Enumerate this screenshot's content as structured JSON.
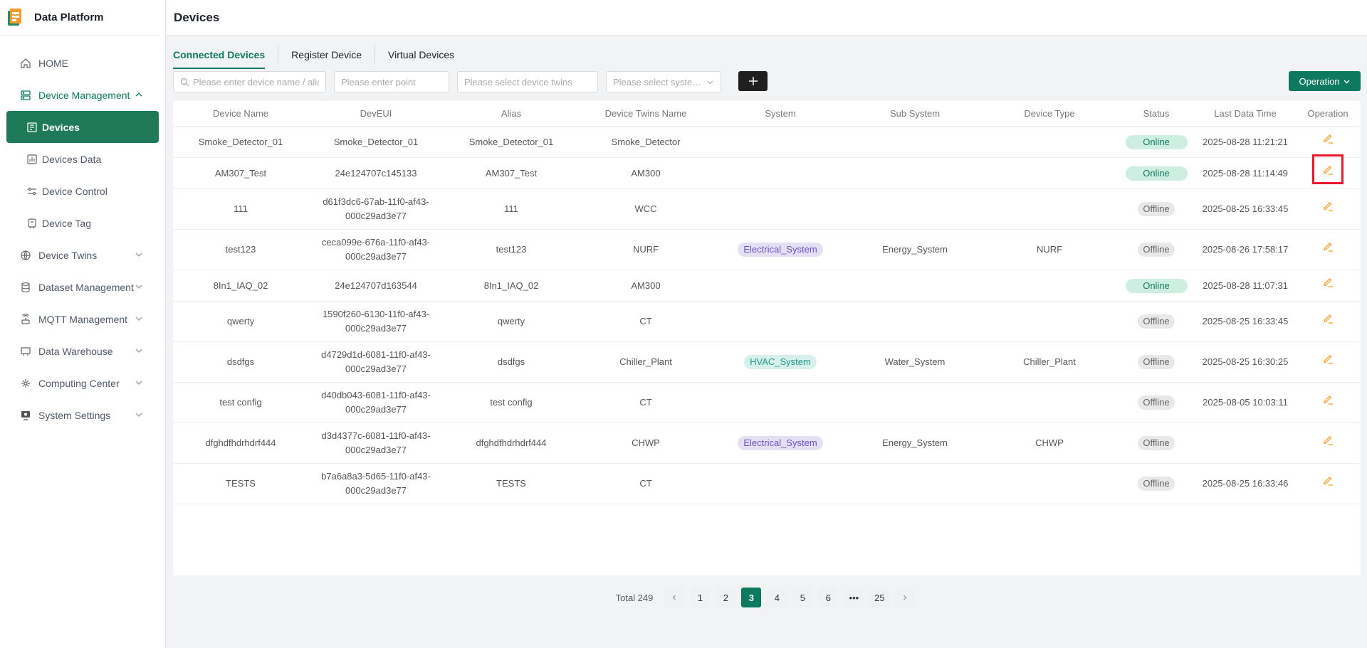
{
  "app": {
    "title": "Data Platform",
    "page_title": "Devices"
  },
  "sidebar": {
    "items": [
      {
        "label": "HOME",
        "icon": "home-icon"
      },
      {
        "label": "Device Management",
        "icon": "device-management-icon"
      },
      {
        "label": "Devices",
        "icon": "devices-icon"
      },
      {
        "label": "Devices Data",
        "icon": "devices-data-icon"
      },
      {
        "label": "Device Control",
        "icon": "device-control-icon"
      },
      {
        "label": "Device Tag",
        "icon": "device-tag-icon"
      },
      {
        "label": "Device Twins",
        "icon": "device-twins-icon"
      },
      {
        "label": "Dataset Management",
        "icon": "dataset-icon"
      },
      {
        "label": "MQTT Management",
        "icon": "mqtt-icon"
      },
      {
        "label": "Data Warehouse",
        "icon": "warehouse-icon"
      },
      {
        "label": "Computing Center",
        "icon": "computing-icon"
      },
      {
        "label": "System Settings",
        "icon": "settings-icon"
      }
    ]
  },
  "tabs": [
    "Connected Devices",
    "Register Device",
    "Virtual Devices"
  ],
  "filters": {
    "device_name_placeholder": "Please enter device name / alias",
    "point_placeholder": "Please enter point",
    "twins_placeholder": "Please select device twins",
    "system_placeholder": "Please select syste…",
    "operation_label": "Operation"
  },
  "table": {
    "columns": [
      "Device Name",
      "DevEUI",
      "Alias",
      "Device Twins Name",
      "System",
      "Sub System",
      "Device Type",
      "Status",
      "Last Data Time",
      "Operation"
    ],
    "rows": [
      {
        "name": "Smoke_Detector_01",
        "deveui": "Smoke_Detector_01",
        "deveui2": "",
        "alias": "Smoke_Detector_01",
        "twins": "Smoke_Detector",
        "system": "",
        "subsystem": "",
        "type": "",
        "status": "Online",
        "time": "2025-08-28 11:21:21"
      },
      {
        "name": "AM307_Test",
        "deveui": "24e124707c145133",
        "deveui2": "",
        "alias": "AM307_Test",
        "twins": "AM300",
        "system": "",
        "subsystem": "",
        "type": "",
        "status": "Online",
        "time": "2025-08-28 11:14:49"
      },
      {
        "name": "111",
        "deveui": "d61f3dc6-67ab-11f0-af43-",
        "deveui2": "000c29ad3e77",
        "alias": "111",
        "twins": "WCC",
        "system": "",
        "subsystem": "",
        "type": "",
        "status": "Offline",
        "time": "2025-08-25 16:33:45"
      },
      {
        "name": "test123",
        "deveui": "ceca099e-676a-11f0-af43-",
        "deveui2": "000c29ad3e77",
        "alias": "test123",
        "twins": "NURF",
        "system": "Electrical_System",
        "subsystem": "Energy_System",
        "type": "NURF",
        "status": "Offline",
        "time": "2025-08-26 17:58:17"
      },
      {
        "name": "8In1_IAQ_02",
        "deveui": "24e124707d163544",
        "deveui2": "",
        "alias": "8In1_IAQ_02",
        "twins": "AM300",
        "system": "",
        "subsystem": "",
        "type": "",
        "status": "Online",
        "time": "2025-08-28 11:07:31"
      },
      {
        "name": "qwerty",
        "deveui": "1590f260-6130-11f0-af43-",
        "deveui2": "000c29ad3e77",
        "alias": "qwerty",
        "twins": "CT",
        "system": "",
        "subsystem": "",
        "type": "",
        "status": "Offline",
        "time": "2025-08-25 16:33:45"
      },
      {
        "name": "dsdfgs",
        "deveui": "d4729d1d-6081-11f0-af43-",
        "deveui2": "000c29ad3e77",
        "alias": "dsdfgs",
        "twins": "Chiller_Plant",
        "system": "HVAC_System",
        "subsystem": "Water_System",
        "type": "Chiller_Plant",
        "status": "Offline",
        "time": "2025-08-25 16:30:25"
      },
      {
        "name": "test config",
        "deveui": "d40db043-6081-11f0-af43-",
        "deveui2": "000c29ad3e77",
        "alias": "test config",
        "twins": "CT",
        "system": "",
        "subsystem": "",
        "type": "",
        "status": "Offline",
        "time": "2025-08-05 10:03:11"
      },
      {
        "name": "dfghdfhdrhdrf444",
        "deveui": "d3d4377c-6081-11f0-af43-",
        "deveui2": "000c29ad3e77",
        "alias": "dfghdfhdrhdrf444",
        "twins": "CHWP",
        "system": "Electrical_System",
        "subsystem": "Energy_System",
        "type": "CHWP",
        "status": "Offline",
        "time": ""
      },
      {
        "name": "TESTS",
        "deveui": "b7a6a8a3-5d65-11f0-af43-",
        "deveui2": "000c29ad3e77",
        "alias": "TESTS",
        "twins": "CT",
        "system": "",
        "subsystem": "",
        "type": "",
        "status": "Offline",
        "time": "2025-08-25 16:33:46"
      }
    ]
  },
  "pagination": {
    "total": "Total 249",
    "pages": [
      "1",
      "2",
      "3",
      "4",
      "5",
      "6",
      "•••",
      "25"
    ],
    "current": "3"
  }
}
